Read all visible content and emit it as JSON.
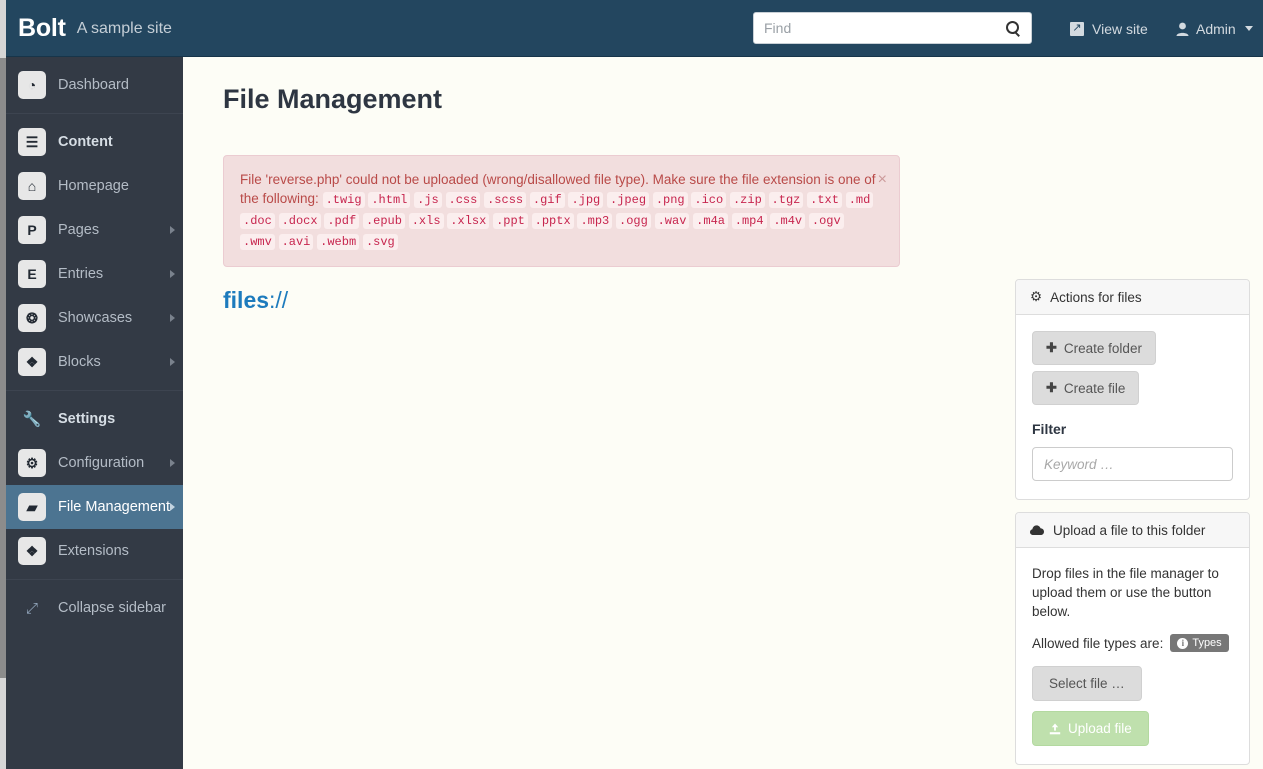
{
  "header": {
    "brand": "Bolt",
    "tagline": "A sample site",
    "search_placeholder": "Find",
    "search_value": "",
    "search_icon": "search-icon",
    "view_site_label": "View site",
    "view_site_icon": "external-link-icon",
    "admin_label": "Admin",
    "admin_icon": "user-icon",
    "admin_caret": "caret-down-icon"
  },
  "sidebar": {
    "groups": [
      {
        "items": [
          {
            "label": "Dashboard",
            "icon": "dashboard-gauge-icon",
            "glyph": "◔",
            "header": false,
            "arrow": false,
            "active": false
          }
        ]
      },
      {
        "items": [
          {
            "label": "Content",
            "icon": "document-icon",
            "glyph": "☰",
            "header": true,
            "arrow": false,
            "active": false
          },
          {
            "label": "Homepage",
            "icon": "home-icon",
            "glyph": "⌂",
            "header": false,
            "arrow": false,
            "active": false
          },
          {
            "label": "Pages",
            "icon": "letter-p-icon",
            "glyph": "P",
            "header": false,
            "arrow": true,
            "active": false
          },
          {
            "label": "Entries",
            "icon": "letter-e-icon",
            "glyph": "E",
            "header": false,
            "arrow": true,
            "active": false
          },
          {
            "label": "Showcases",
            "icon": "gift-icon",
            "glyph": "❂",
            "header": false,
            "arrow": true,
            "active": false
          },
          {
            "label": "Blocks",
            "icon": "cubes-icon",
            "glyph": "❖",
            "header": false,
            "arrow": true,
            "active": false
          }
        ]
      },
      {
        "items": [
          {
            "label": "Settings",
            "icon": "wrench-icon",
            "glyph": "🔧",
            "header": true,
            "arrow": false,
            "active": false,
            "plain": true
          },
          {
            "label": "Configuration",
            "icon": "cogs-icon",
            "glyph": "⚙",
            "header": false,
            "arrow": true,
            "active": false
          },
          {
            "label": "File Management",
            "icon": "folder-open-icon",
            "glyph": "▰",
            "header": false,
            "arrow": true,
            "active": true
          },
          {
            "label": "Extensions",
            "icon": "cubes-icon",
            "glyph": "❖",
            "header": false,
            "arrow": false,
            "active": false
          }
        ]
      },
      {
        "items": [
          {
            "label": "Collapse sidebar",
            "icon": "collapse-arrows-icon",
            "glyph": "⤢",
            "header": false,
            "arrow": false,
            "active": false,
            "plain": true
          }
        ]
      }
    ]
  },
  "main": {
    "page_title": "File Management",
    "alert": {
      "icon": "close-icon",
      "close_label": "×",
      "lead": "File 'reverse.php' could not be uploaded (wrong/disallowed file type). Make sure the file extension is one of the following:",
      "extensions": [
        ".twig",
        ".html",
        ".js",
        ".css",
        ".scss",
        ".gif",
        ".jpg",
        ".jpeg",
        ".png",
        ".ico",
        ".zip",
        ".tgz",
        ".txt",
        ".md",
        ".doc",
        ".docx",
        ".pdf",
        ".epub",
        ".xls",
        ".xlsx",
        ".ppt",
        ".pptx",
        ".mp3",
        ".ogg",
        ".wav",
        ".m4a",
        ".mp4",
        ".m4v",
        ".ogv",
        ".wmv",
        ".avi",
        ".webm",
        ".svg"
      ]
    },
    "breadcrumb": {
      "root": "files",
      "separator": "://"
    }
  },
  "panels": {
    "actions": {
      "icon": "gear-icon",
      "title": "Actions for files",
      "create_folder_label": "Create folder",
      "create_file_label": "Create file",
      "plus_icon": "plus-icon",
      "filter_label": "Filter",
      "filter_placeholder": "Keyword …",
      "filter_value": ""
    },
    "upload": {
      "icon": "cloud-upload-icon",
      "title": "Upload a file to this folder",
      "description": "Drop files in the file manager to upload them or use the button below.",
      "allowed_label": "Allowed file types are:",
      "types_badge": "Types",
      "types_badge_icon": "info-icon",
      "select_file_label": "Select file …",
      "upload_file_label": "Upload file",
      "upload_icon": "upload-icon"
    }
  },
  "colors": {
    "header_bg": "#23465f",
    "sidebar_bg": "#333a45",
    "sidebar_active": "#4c7491",
    "content_bg": "#fdfdf6",
    "alert_bg": "#f2dede",
    "alert_text": "#b94a48",
    "link_blue": "#1d7bbd",
    "success_btn": "#bfe0ad"
  }
}
